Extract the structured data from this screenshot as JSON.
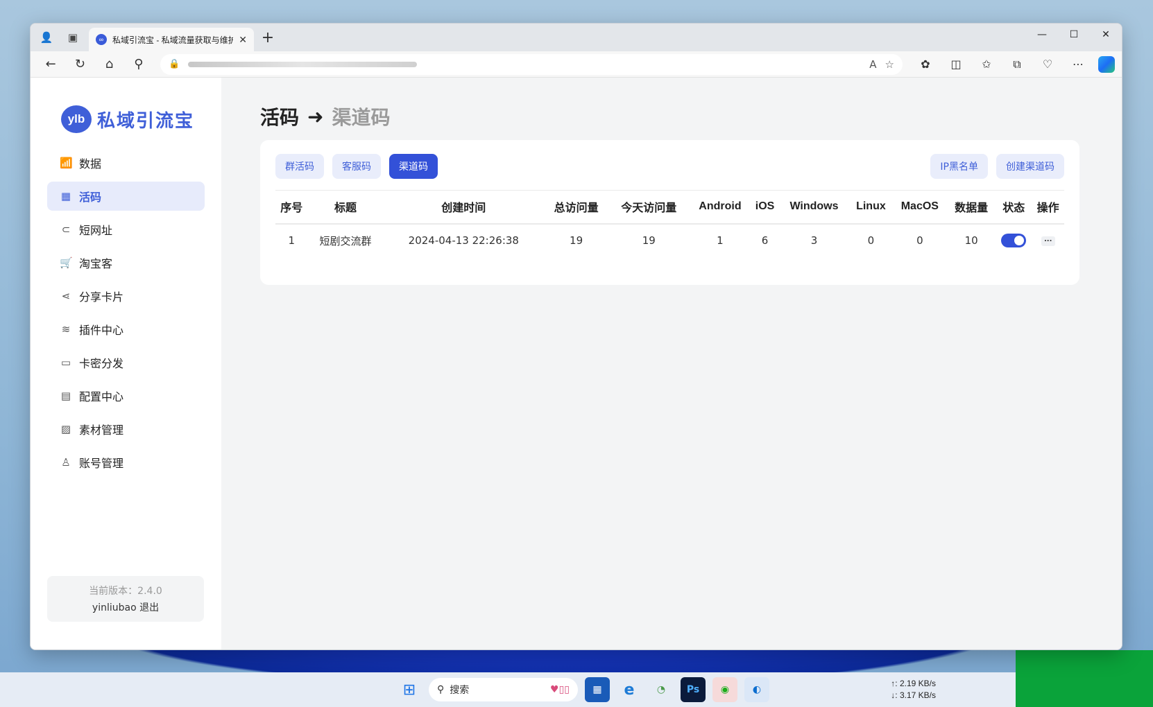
{
  "browser": {
    "tab_title": "私域引流宝 - 私域流量获取与维护",
    "favicon_text": "∞",
    "new_tab_symbol": "+",
    "window_controls": [
      "—",
      "☐",
      "✕"
    ]
  },
  "sidebar": {
    "logo_badge": "ylb",
    "logo_text": "私域引流宝",
    "items": [
      {
        "label": "数据",
        "icon": "📶"
      },
      {
        "label": "活码",
        "icon": "▦"
      },
      {
        "label": "短网址",
        "icon": "⊂"
      },
      {
        "label": "淘宝客",
        "icon": "🛒"
      },
      {
        "label": "分享卡片",
        "icon": "⋖"
      },
      {
        "label": "插件中心",
        "icon": "≋"
      },
      {
        "label": "卡密分发",
        "icon": "▭"
      },
      {
        "label": "配置中心",
        "icon": "▤"
      },
      {
        "label": "素材管理",
        "icon": "▨"
      },
      {
        "label": "账号管理",
        "icon": "♙"
      }
    ],
    "active_index": 1,
    "version": "当前版本：2.4.0",
    "user": "yinliubao 退出"
  },
  "main": {
    "title_root": "活码",
    "title_arrow": "➜",
    "title_current": "渠道码",
    "tabs": [
      "群活码",
      "客服码",
      "渠道码"
    ],
    "active_tab": 2,
    "actions": [
      "IP黑名单",
      "创建渠道码"
    ],
    "table": {
      "headers": [
        "序号",
        "标题",
        "创建时间",
        "总访问量",
        "今天访问量",
        "Android",
        "iOS",
        "Windows",
        "Linux",
        "MacOS",
        "数据量",
        "状态",
        "操作"
      ],
      "rows": [
        {
          "index": "1",
          "title": "短剧交流群",
          "created": "2024-04-13 22:26:38",
          "total": "19",
          "today": "19",
          "android": "1",
          "ios": "6",
          "windows": "3",
          "linux": "0",
          "macos": "0",
          "data": "10",
          "status_on": true,
          "more": "..."
        }
      ]
    }
  },
  "taskbar": {
    "search_placeholder": "搜索",
    "net_up": "↑: 2.19 KB/s",
    "net_down": "↓: 3.17 KB/s"
  }
}
